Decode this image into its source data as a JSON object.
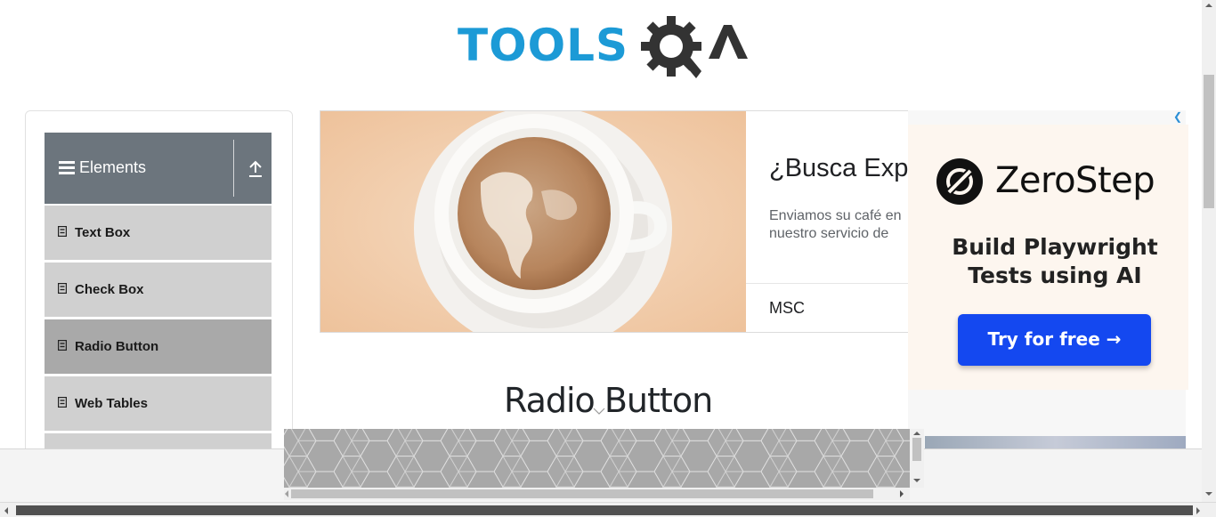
{
  "header": {
    "logo_text": "TOOLSQA",
    "logo_tools": "TOOLS",
    "logo_accent_color": "#1c9ad6",
    "logo_dark_color": "#333333"
  },
  "sidebar": {
    "group_title": "Elements",
    "group_icon": "hamburger-icon",
    "collapse_icon": "arrow-up-icon",
    "header_color": "#6c757d",
    "items": [
      {
        "label": "Text Box",
        "icon": "form-icon",
        "active": false
      },
      {
        "label": "Check Box",
        "icon": "form-icon",
        "active": false
      },
      {
        "label": "Radio Button",
        "icon": "form-icon",
        "active": true
      },
      {
        "label": "Web Tables",
        "icon": "form-icon",
        "active": false
      }
    ]
  },
  "ad_banner": {
    "title": "¿Busca Expo",
    "body_line1": "Enviamos su café en",
    "body_line2": "nuestro servicio de",
    "brand": "MSC"
  },
  "side_ad": {
    "brand": "ZeroStep",
    "tagline_line1": "Build Playwright",
    "tagline_line2": "Tests using AI",
    "cta": "Try for free →",
    "cta_color": "#1448f0"
  },
  "main": {
    "heading": "Radio Button"
  }
}
